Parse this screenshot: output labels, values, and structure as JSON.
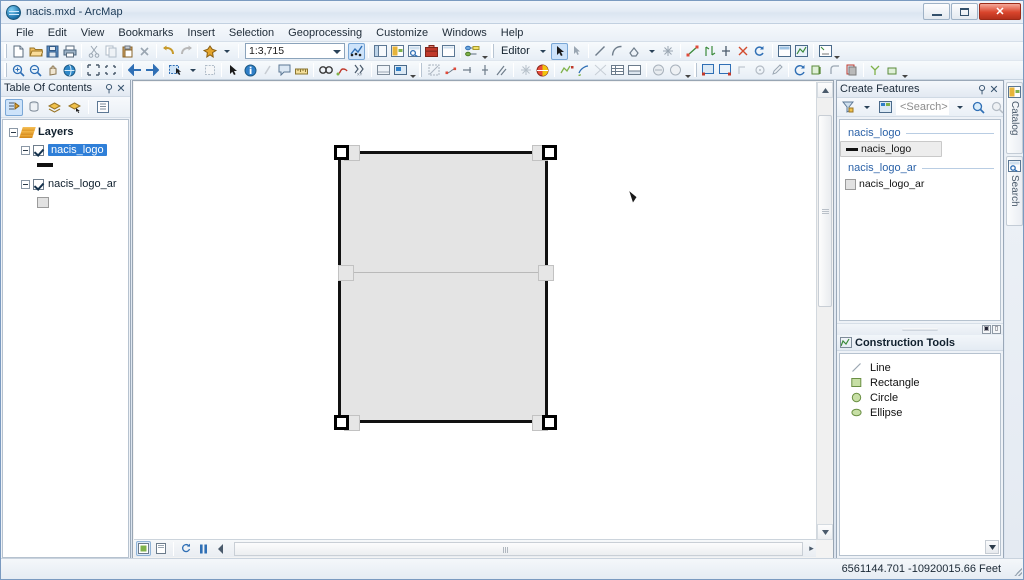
{
  "window": {
    "title": "nacis.mxd - ArcMap",
    "app_icon": "globe-icon",
    "minimize": "minimize-icon",
    "maximize": "maximize-icon",
    "close": "close-icon"
  },
  "menu": {
    "items": [
      {
        "label": "File"
      },
      {
        "label": "Edit"
      },
      {
        "label": "View"
      },
      {
        "label": "Bookmarks"
      },
      {
        "label": "Insert"
      },
      {
        "label": "Selection"
      },
      {
        "label": "Geoprocessing"
      },
      {
        "label": "Customize"
      },
      {
        "label": "Windows"
      },
      {
        "label": "Help"
      }
    ]
  },
  "standard_toolbar": {
    "scale_value": "1:3,715",
    "editor_label": "Editor",
    "buttons": [
      "new-document-icon",
      "open-folder-icon",
      "save-icon",
      "print-icon",
      "cut-icon",
      "copy-icon",
      "paste-icon",
      "delete-icon",
      "undo-icon",
      "redo-icon",
      "add-data-icon"
    ],
    "after_scale": [
      "editor-toolbar-icon",
      "table-of-contents-icon",
      "catalog-window-icon",
      "search-window-icon",
      "arctoolbox-icon",
      "python-window-icon",
      "model-builder-icon"
    ]
  },
  "tools_toolbar": {
    "buttons": [
      "zoom-in-icon",
      "zoom-out-icon",
      "pan-icon",
      "full-extent-icon",
      "fixed-zoom-in-icon",
      "fixed-zoom-out-icon",
      "go-back-extent-icon",
      "go-forward-extent-icon",
      "select-features-icon",
      "clear-selection-icon",
      "select-elements-icon",
      "identify-icon",
      "hyperlink-icon",
      "html-popup-icon",
      "measure-icon",
      "find-icon",
      "find-route-icon",
      "go-to-xy-icon",
      "time-slider-icon",
      "create-viewer-window-icon"
    ]
  },
  "editor_toolbar": {
    "label": "Editor",
    "buttons": [
      "edit-tool-icon",
      "edit-annotation-icon",
      "straight-segment-icon",
      "end-point-arc-icon",
      "trace-icon",
      "point-icon",
      "edit-vertices-icon",
      "reshape-feature-icon",
      "cut-polygons-icon",
      "split-icon",
      "rotate-icon",
      "attributes-icon",
      "sketch-properties-icon",
      "create-features-window-icon"
    ]
  },
  "table_of_contents": {
    "title": "Table Of Contents",
    "pin_icon": "pin-icon",
    "close_icon": "close-icon",
    "tools": [
      "list-by-drawing-order-icon",
      "list-by-source-icon",
      "list-by-visibility-icon",
      "list-by-selection-icon",
      "options-icon"
    ],
    "tree": {
      "root": {
        "label": "Layers",
        "icon": "layers-icon",
        "expanded": true
      },
      "layers": [
        {
          "label": "nacis_logo",
          "checked": true,
          "selected": true,
          "expanded": true,
          "symbol": "line-symbol"
        },
        {
          "label": "nacis_logo_ar",
          "checked": true,
          "selected": false,
          "expanded": true,
          "symbol": "polygon-symbol"
        }
      ]
    }
  },
  "create_features": {
    "title": "Create Features",
    "pin_icon": "pin-icon",
    "close_icon": "close-icon",
    "search_placeholder": "<Search>",
    "search_value": "",
    "toolbar_icons": [
      "filter-icon",
      "organize-templates-icon",
      "search-icon",
      "clear-search-icon"
    ],
    "groups": [
      {
        "name": "nacis_logo",
        "templates": [
          {
            "label": "nacis_logo",
            "symbol": "line-symbol",
            "selected": true
          }
        ]
      },
      {
        "name": "nacis_logo_ar",
        "templates": [
          {
            "label": "nacis_logo_ar",
            "symbol": "polygon-symbol",
            "selected": false
          }
        ]
      }
    ],
    "mini_buttons": [
      "restore-icon",
      "close-icon"
    ]
  },
  "construction_tools": {
    "title": "Construction Tools",
    "icon": "construction-tools-icon",
    "items": [
      {
        "label": "Line",
        "icon": "line-tool-icon"
      },
      {
        "label": "Rectangle",
        "icon": "rectangle-tool-icon"
      },
      {
        "label": "Circle",
        "icon": "circle-tool-icon"
      },
      {
        "label": "Ellipse",
        "icon": "ellipse-tool-icon"
      }
    ],
    "scroll_icon": "chevron-down-icon"
  },
  "side_tabs": [
    {
      "label": "Catalog",
      "icon": "catalog-icon"
    },
    {
      "label": "Search",
      "icon": "search-icon"
    }
  ],
  "map": {
    "feature": {
      "type": "rectangle-sketch",
      "handles": 4,
      "midpoint_handles": 2
    },
    "cursor": "arrow-cursor",
    "bottom_bar": {
      "buttons": [
        "data-view-icon",
        "layout-view-icon",
        "refresh-icon",
        "pause-drawing-icon",
        "toggle-icon"
      ]
    },
    "scrollbar": {
      "vertical": true,
      "horizontal": true
    }
  },
  "status_bar": {
    "coordinates": "6561144.701  -10920015.66 Feet"
  },
  "colors": {
    "selection_blue": "#2f7fd8",
    "group_heading": "#2b62a8",
    "close_red": "#d9452c",
    "feature_fill": "#e4e4e4",
    "feature_stroke": "#111111"
  }
}
